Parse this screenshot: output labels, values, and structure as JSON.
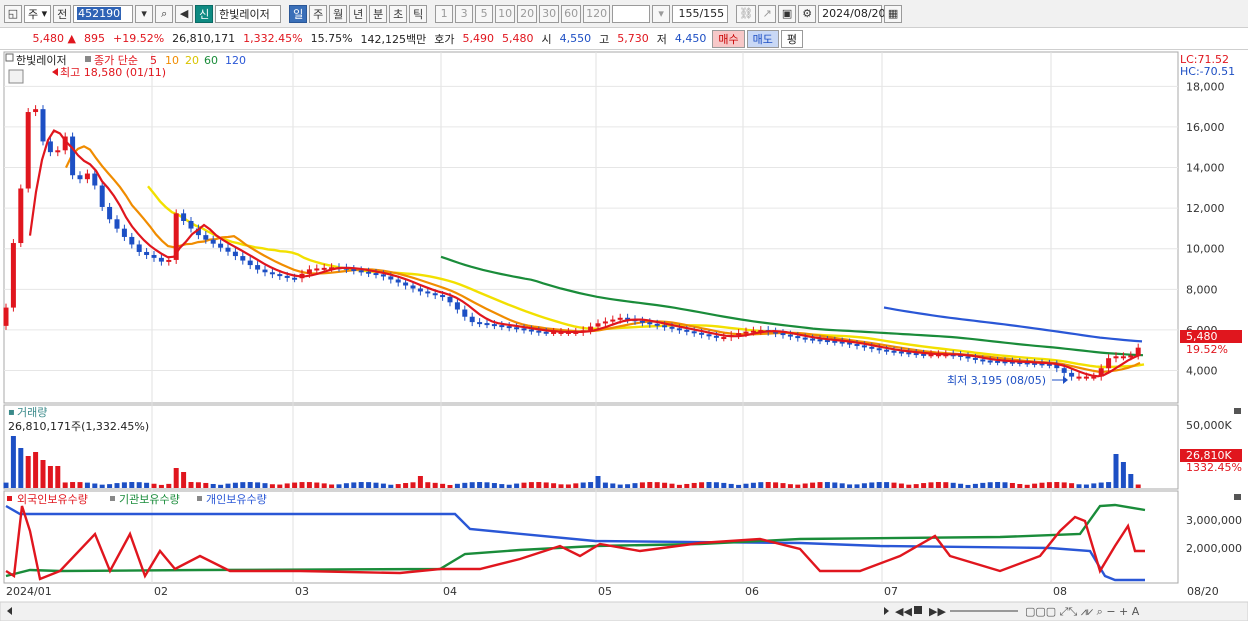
{
  "toolbar": {
    "market_label": "주",
    "prev_label": "전",
    "code": "452190",
    "new_badge": "신",
    "stock_name": "한빛레이저",
    "periods": [
      "일",
      "주",
      "월",
      "년",
      "분",
      "초",
      "틱"
    ],
    "active_period": "일",
    "intervals": [
      "1",
      "3",
      "5",
      "10",
      "20",
      "30",
      "60",
      "120"
    ],
    "count": "155",
    "count_total": "/155",
    "date": "2024/08/20"
  },
  "quote": {
    "price": "5,480",
    "change": "895",
    "change_pct": "+19.52%",
    "volume": "26,810,171",
    "volume_ratio": "1,332.45%",
    "turnover": "15.75%",
    "amount": "142,125백만",
    "hoga_label": "호가",
    "ask": "5,490",
    "bid": "5,480",
    "open_label": "시",
    "open": "4,550",
    "high_label": "고",
    "high": "5,730",
    "low_label": "저",
    "low": "4,450",
    "buy_label": "매수",
    "sell_label": "매도",
    "avg_label": "평"
  },
  "price_panel": {
    "stock_name": "한빛레이저",
    "legend_prefix": "종가 단순",
    "ma_periods": [
      "5",
      "10",
      "20",
      "60",
      "120"
    ],
    "ma_colors": [
      "#e0161e",
      "#f08c00",
      "#f2e000",
      "#1a8c3a",
      "#2a57d6"
    ],
    "high_note": "최고 18,580 (01/11)",
    "low_note": "최저 3,195 (08/05)",
    "lc": "LC:71.52",
    "hc": "HC:-70.51",
    "current_price": "5,480",
    "current_pct": "19.52%",
    "y_ticks": [
      "18,000",
      "16,000",
      "14,000",
      "12,000",
      "10,000",
      "8,000",
      "6,000",
      "4,000"
    ]
  },
  "volume_panel": {
    "title": "거래량",
    "value_label": "26,810,171주(1,332.45%)",
    "y_tick": "50,000K",
    "current": "26,810K",
    "current_pct": "1332.45%"
  },
  "holding_panel": {
    "series": [
      "외국인보유수량",
      "기관보유수량",
      "개인보유수량"
    ],
    "colors": [
      "#e0161e",
      "#1a8c3a",
      "#2a57d6"
    ],
    "y_ticks": [
      "3,000,000",
      "2,000,000"
    ]
  },
  "x_axis": {
    "labels": [
      "2024/01",
      "02",
      "03",
      "04",
      "05",
      "06",
      "07",
      "08",
      "08/20"
    ]
  }
}
